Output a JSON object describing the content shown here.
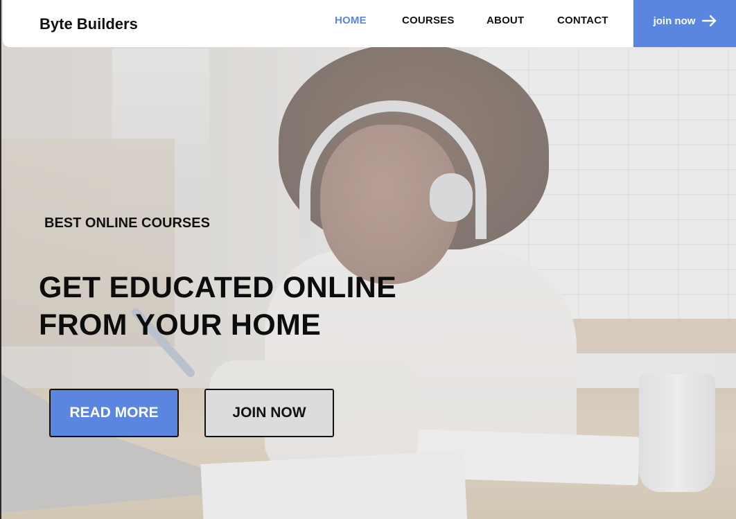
{
  "brand": {
    "name": "Byte Builders"
  },
  "nav": {
    "items": [
      {
        "label": "HOME",
        "active": true
      },
      {
        "label": "COURSES",
        "active": false
      },
      {
        "label": "ABOUT",
        "active": false
      },
      {
        "label": "CONTACT",
        "active": false
      }
    ],
    "cta_label": "join now",
    "cta_icon": "arrow-right-icon"
  },
  "hero": {
    "tagline": "BEST ONLINE COURSES",
    "headline_line1": "GET EDUCATED ONLINE",
    "headline_line2": "FROM YOUR HOME",
    "primary_button": "READ MORE",
    "secondary_button": "JOIN NOW"
  },
  "colors": {
    "accent": "#5b86df",
    "text": "#111111",
    "header_bg": "#ffffff",
    "secondary_button_bg": "#dcdcdc"
  }
}
